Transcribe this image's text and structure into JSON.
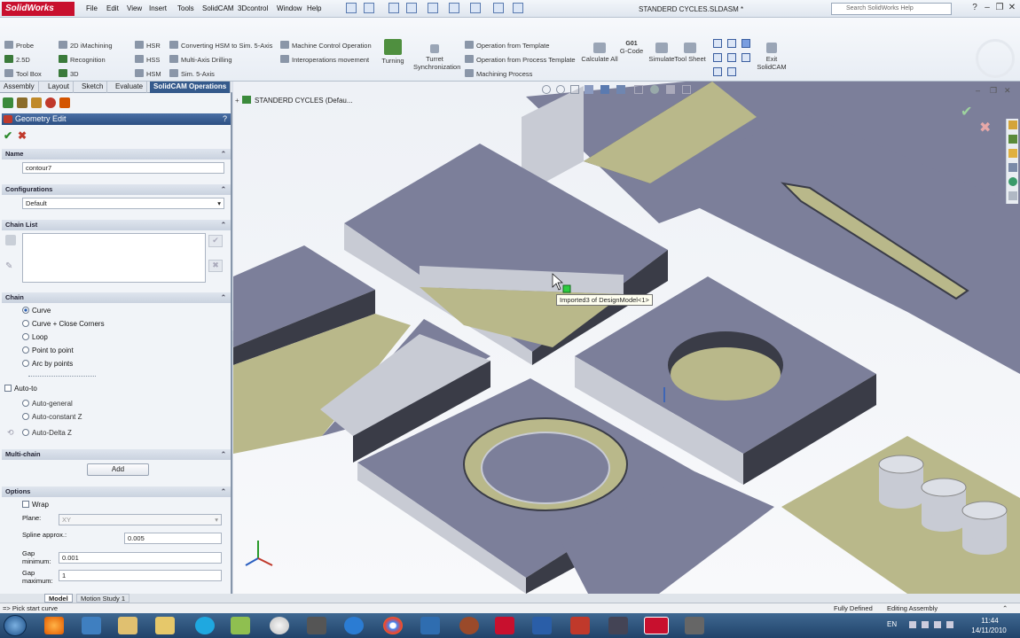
{
  "titlebar": {
    "app_logo": "SolidWorks",
    "menus": [
      "File",
      "Edit",
      "View",
      "Insert",
      "Tools",
      "SolidCAM",
      "3Dcontrol",
      "Window",
      "Help"
    ],
    "doc_title": "STANDERD CYCLES.SLDASM *",
    "search_placeholder": "Search SolidWorks Help"
  },
  "ribbon": {
    "col1": [
      "Probe",
      "2.5D",
      "Tool Box"
    ],
    "col2": [
      "2D iMachining",
      "Recognition",
      "3D"
    ],
    "col3": [
      "HSR",
      "HSS",
      "HSM"
    ],
    "col4": [
      "Converting HSM to Sim. 5-Axis",
      "Multi-Axis Drilling",
      "Sim. 5-Axis"
    ],
    "col5": [
      "Machine Control Operation",
      "Interoperations movement"
    ],
    "turning": "Turning",
    "turret": "Turret Synchronization",
    "col6": [
      "Operation from Template",
      "Operation from Process Template",
      "Machining Process"
    ],
    "calculate": "Calculate All",
    "gcode_code": "G01",
    "gcode": "G-Code",
    "simulate": "Simulate",
    "toolsheet": "Tool Sheet",
    "exit": "Exit SolidCAM"
  },
  "tabs": [
    "Assembly",
    "Layout",
    "Sketch",
    "Evaluate",
    "SolidCAM Operations"
  ],
  "panel": {
    "title": "Geometry Edit",
    "name_header": "Name",
    "name_value": "contour7",
    "config_header": "Configurations",
    "config_value": "Default",
    "chainlist_header": "Chain List",
    "chain_header": "Chain",
    "chain_options": [
      "Curve",
      "Curve + Close Corners",
      "Loop",
      "Point to point",
      "Arc by points"
    ],
    "autoto": "Auto-to",
    "autoto_options": [
      "Auto-general",
      "Auto-constant Z",
      "Auto-Delta Z"
    ],
    "multichain_header": "Multi-chain",
    "add_button": "Add",
    "options_header": "Options",
    "wrap": "Wrap",
    "plane_label": "Plane:",
    "plane_value": "XY",
    "spline_label": "Spline approx.:",
    "spline_value": "0.005",
    "gapmin_label": "Gap minimum:",
    "gapmin_value": "0.001",
    "gapmax_label": "Gap maximum:",
    "gapmax_value": "1"
  },
  "viewport": {
    "tree_label": "STANDERD CYCLES  (Defau...",
    "tooltip": "Imported3 of DesignModel<1>"
  },
  "bottom_tabs": [
    "Model",
    "Motion Study 1"
  ],
  "status": {
    "hint": "=> Pick start curve",
    "defined": "Fully Defined",
    "mode": "Editing Assembly"
  },
  "taskbar": {
    "lang": "EN",
    "time": "11:44",
    "date": "14/11/2010"
  },
  "colors": {
    "face_top": "#7c7f9a",
    "face_side": "#c8cbd4",
    "face_dark": "#3a3c47",
    "face_floor": "#b9b88a",
    "accent": "#355a8c"
  }
}
